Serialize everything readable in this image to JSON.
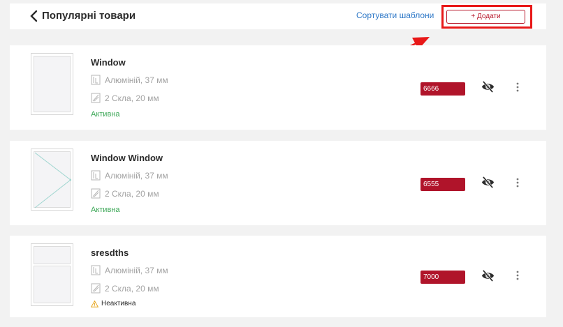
{
  "header": {
    "back_icon": "chevron-left-icon",
    "title": "Популярні товари",
    "sort_label": "Сортувати шаблони",
    "add_label": "+ Додати"
  },
  "colors": {
    "accent": "#b0142a",
    "link": "#2e78c7",
    "active_status": "#3aa655",
    "highlight_box": "#e81818"
  },
  "items": [
    {
      "name": "Window",
      "material": "Алюміній, 37 мм",
      "glass": "2 Скла, 20 мм",
      "status": "Активна",
      "price": "6666",
      "thumbnail": "single-pane-window"
    },
    {
      "name": "Window Window",
      "material": "Алюміній, 37 мм",
      "glass": "2 Скла, 20 мм",
      "status": "Активна",
      "price": "6555",
      "thumbnail": "casement-window"
    },
    {
      "name": "sresdths",
      "material": "Алюміній, 37 мм",
      "glass": "2 Скла, 20 мм",
      "status": "Неактивна",
      "price": "7000",
      "thumbnail": "transom-window"
    }
  ]
}
